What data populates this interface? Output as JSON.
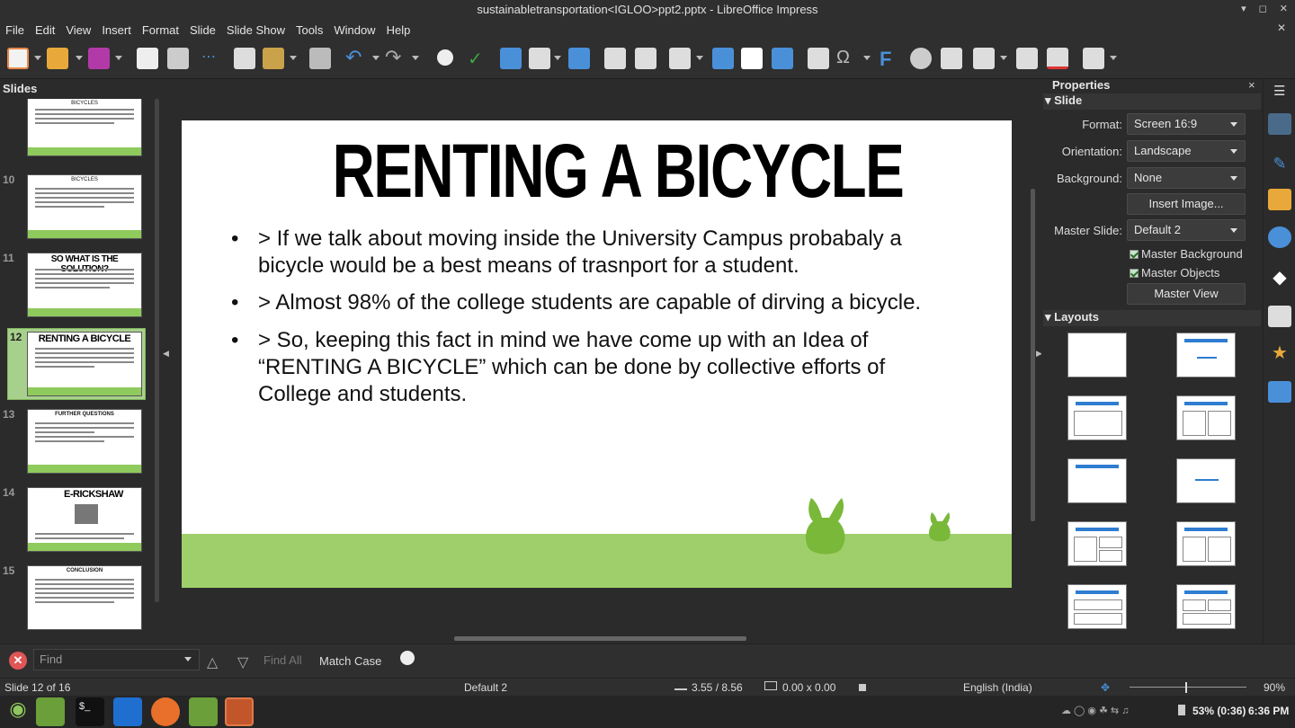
{
  "window": {
    "title": "sustainabletransportation<IGLOO>ppt2.pptx - LibreOffice Impress"
  },
  "menu": [
    "File",
    "Edit",
    "View",
    "Insert",
    "Format",
    "Slide",
    "Slide Show",
    "Tools",
    "Window",
    "Help"
  ],
  "slides_panel": {
    "title": "Slides",
    "items": [
      {
        "num": "",
        "title": "BICYCLES"
      },
      {
        "num": "10",
        "title": "BICYCLES"
      },
      {
        "num": "11",
        "title": "SO WHAT IS THE SOLUTION?"
      },
      {
        "num": "12",
        "title": "RENTING A BICYCLE"
      },
      {
        "num": "13",
        "title": "FURTHER QUESTIONS"
      },
      {
        "num": "14",
        "title": "E-RICKSHAW"
      },
      {
        "num": "15",
        "title": "CONCLUSION"
      }
    ]
  },
  "slide": {
    "title": "RENTING A BICYCLE",
    "bullets": [
      {
        "lines": [
          "> If we talk about moving inside the University Campus probabaly a",
          "bicycle would be a best means of trasnport for a student."
        ]
      },
      {
        "lines": [
          "> Almost 98% of the college students are capable of dirving a bicycle."
        ]
      },
      {
        "lines": [
          "> So, keeping this fact in mind we have come up with an Idea of",
          "“RENTING A BICYCLE” which can be done by collective efforts of",
          "College and students."
        ]
      }
    ],
    "bullet_char": "•"
  },
  "properties": {
    "title": "Properties",
    "slide_section": "Slide",
    "format_label": "Format:",
    "format_value": "Screen 16:9",
    "orientation_label": "Orientation:",
    "orientation_value": "Landscape",
    "background_label": "Background:",
    "background_value": "None",
    "insert_image": "Insert Image...",
    "master_label": "Master Slide:",
    "master_value": "Default 2",
    "master_background": "Master Background",
    "master_objects": "Master Objects",
    "master_view": "Master View",
    "layouts_section": "Layouts"
  },
  "findbar": {
    "placeholder": "Find",
    "find_all": "Find All",
    "match_case": "Match Case"
  },
  "status": {
    "slide": "Slide 12 of 16",
    "master": "Default 2",
    "position": "3.55 / 8.56",
    "size": "0.00 x 0.00",
    "language": "English (India)",
    "zoom": "90%"
  },
  "taskbar": {
    "battery": "53% (0:36)",
    "time": "6:36 PM"
  },
  "colors": {
    "grass": "#9fcf6a",
    "accent": "#2e7dd1",
    "thumb_selected": "#a8d08d"
  }
}
